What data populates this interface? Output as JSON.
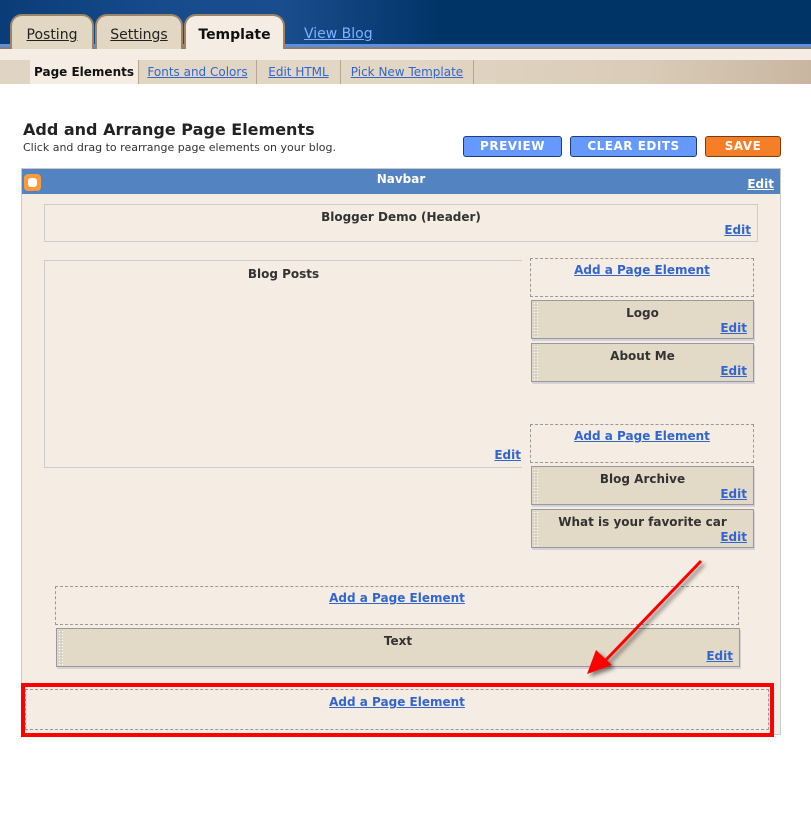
{
  "header": {
    "tabs": [
      {
        "label": "Posting",
        "active": false
      },
      {
        "label": "Settings",
        "active": false
      },
      {
        "label": "Template",
        "active": true
      }
    ],
    "view_blog": "View Blog"
  },
  "subtabs": [
    {
      "label": "Page Elements",
      "active": true
    },
    {
      "label": "Fonts and Colors",
      "active": false
    },
    {
      "label": "Edit HTML",
      "active": false
    },
    {
      "label": "Pick New Template",
      "active": false
    }
  ],
  "page": {
    "title": "Add and Arrange Page Elements",
    "subtitle": "Click and drag to rearrange page elements on your blog."
  },
  "toolbar": {
    "preview": "PREVIEW",
    "clear_edits": "CLEAR EDITS",
    "save": "SAVE"
  },
  "layout": {
    "navbar": {
      "title": "Navbar",
      "edit": "Edit"
    },
    "header": {
      "title": "Blogger Demo (Header)",
      "edit": "Edit"
    },
    "main": {
      "title": "Blog Posts",
      "edit": "Edit"
    },
    "add_label": "Add a Page Element",
    "sidebar_top_widgets": [
      {
        "title": "Logo",
        "edit": "Edit"
      },
      {
        "title": "About Me",
        "edit": "Edit"
      }
    ],
    "sidebar_bottom_widgets": [
      {
        "title": "Blog Archive",
        "edit": "Edit"
      },
      {
        "title": "What is your favorite car",
        "edit": "Edit"
      }
    ],
    "footer_widgets": [
      {
        "title": "Text",
        "edit": "Edit"
      }
    ]
  },
  "annotation": {
    "highlight_color": "#ff0000",
    "target": "Add a Page Element"
  },
  "colors": {
    "navbar_blue": "#5383c1",
    "link_blue": "#3366cc",
    "save_orange": "#f57e26",
    "button_blue": "#6699ff"
  }
}
